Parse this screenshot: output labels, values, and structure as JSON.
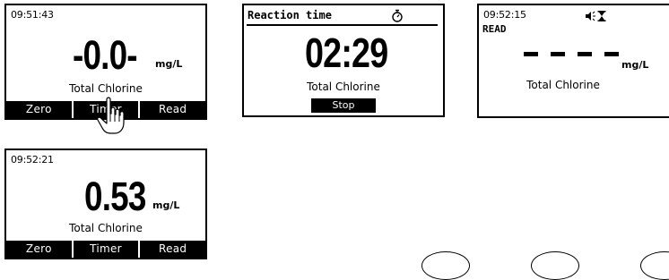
{
  "screen1": {
    "time": "09:51:43",
    "value": "-0.0-",
    "unit": "mg/L",
    "parameter": "Total Chlorine",
    "softkeys": [
      "Zero",
      "Timer",
      "Read"
    ]
  },
  "screen2": {
    "title": "Reaction time",
    "icon": "stopwatch-icon",
    "countdown": "02:29",
    "parameter": "Total Chlorine",
    "button": "Stop"
  },
  "screen3": {
    "time": "09:52:15",
    "icons": [
      "speaker-icon",
      "hourglass-icon"
    ],
    "status": "READ",
    "unit": "mg/L",
    "parameter": "Total Chlorine"
  },
  "screen4": {
    "time": "09:52:21",
    "value": "0.53",
    "unit": "mg/L",
    "parameter": "Total Chlorine",
    "softkeys": [
      "Zero",
      "Timer",
      "Read"
    ]
  }
}
